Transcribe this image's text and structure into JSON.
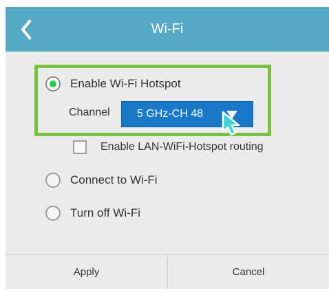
{
  "header": {
    "title": "Wi-Fi",
    "back_icon": "chevron-left-icon"
  },
  "hotspot_option": {
    "label": "Enable Wi-Fi Hotspot",
    "selected": true
  },
  "channel": {
    "label": "Channel",
    "value": "5 GHz-CH 48",
    "dropdown_icon": "triangle-down-icon"
  },
  "routing": {
    "label": "Enable LAN-WiFi-Hotspot routing",
    "checked": false
  },
  "connect_option": {
    "label": "Connect to Wi-Fi",
    "selected": false
  },
  "off_option": {
    "label": "Turn off Wi-Fi",
    "selected": false
  },
  "footer": {
    "apply_label": "Apply",
    "cancel_label": "Cancel"
  },
  "colors": {
    "header": "#56a9c4",
    "highlight_border": "#79c143",
    "dropdown": "#1978c8",
    "radio_selected": "#22cc44",
    "cursor": "#3fd0d8"
  }
}
